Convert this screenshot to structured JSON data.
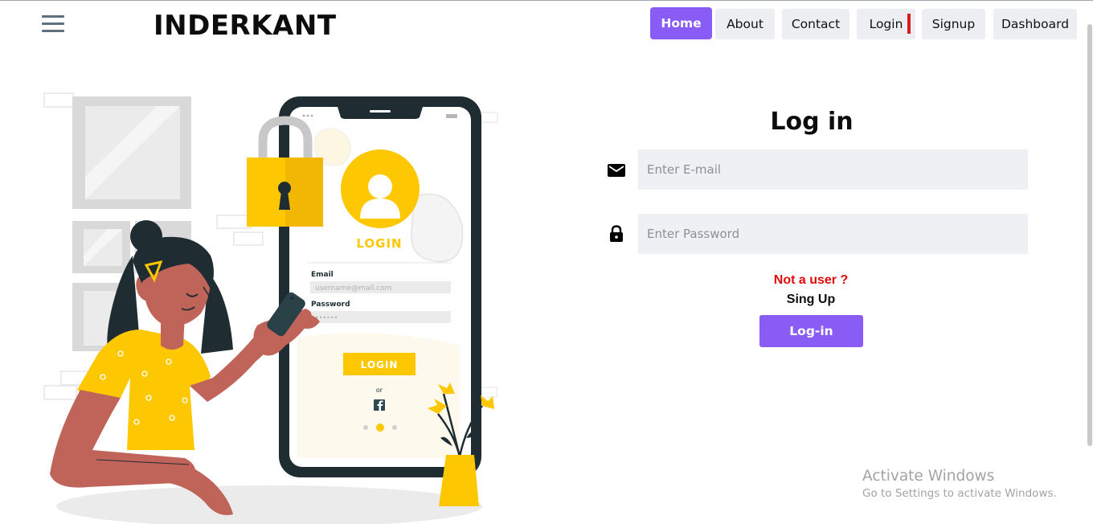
{
  "header": {
    "brand": "INDERKANT",
    "nav": [
      {
        "label": "Home",
        "active": true
      },
      {
        "label": "About",
        "active": false
      },
      {
        "label": "Contact",
        "active": false
      },
      {
        "label": "Login",
        "active": false
      },
      {
        "label": "Signup",
        "active": false
      },
      {
        "label": "Dashboard",
        "active": false
      }
    ]
  },
  "illustration": {
    "phone_login_heading": "LOGIN",
    "email_label": "Email",
    "email_placeholder": "username@mail.com",
    "password_label": "Password",
    "password_dots": "••••••",
    "login_button": "LOGIN",
    "or_text": "or"
  },
  "form": {
    "title": "Log in",
    "email_placeholder": "Enter E-mail",
    "password_placeholder": "Enter Password",
    "not_user": "Not a user ?",
    "signup_link": "Sing Up",
    "submit_label": "Log-in"
  },
  "watermark": {
    "title": "Activate Windows",
    "subtitle": "Go to Settings to activate Windows."
  },
  "colors": {
    "accent": "#8a5cf6",
    "warning_text": "#e00b0b",
    "illustration_yellow": "#fdc702",
    "illustration_skin": "#c0645a",
    "illustration_dark": "#1f2d32"
  }
}
